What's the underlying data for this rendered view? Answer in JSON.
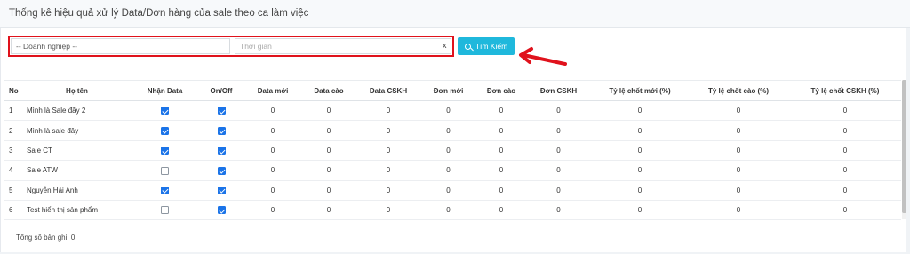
{
  "page": {
    "title": "Thống kê hiệu quả xử lý Data/Đơn hàng của sale theo ca làm việc"
  },
  "filters": {
    "company_select": "-- Doanh nghiệp --",
    "time_placeholder": "Thời gian",
    "clear_label": "x",
    "search_label": "Tìm Kiếm"
  },
  "colors": {
    "accent": "#1fb8dc",
    "highlight": "#e0121c",
    "checkbox": "#1a73e8"
  },
  "table": {
    "headers": [
      "No",
      "Họ tên",
      "Nhận Data",
      "On/Off",
      "Data mới",
      "Data cào",
      "Data CSKH",
      "Đơn mới",
      "Đơn cào",
      "Đơn CSKH",
      "Tỷ lệ chốt mới (%)",
      "Tỷ lệ chốt cào (%)",
      "Tỷ lệ chốt CSKH (%)"
    ],
    "rows": [
      {
        "no": "1",
        "name": "Mình là Sale đây 2",
        "nhan_data": true,
        "on_off": true,
        "values": [
          "0",
          "0",
          "0",
          "0",
          "0",
          "0",
          "0",
          "0",
          "0"
        ]
      },
      {
        "no": "2",
        "name": "Mình là sale đây",
        "nhan_data": true,
        "on_off": true,
        "values": [
          "0",
          "0",
          "0",
          "0",
          "0",
          "0",
          "0",
          "0",
          "0"
        ]
      },
      {
        "no": "3",
        "name": "Sale CT",
        "nhan_data": true,
        "on_off": true,
        "values": [
          "0",
          "0",
          "0",
          "0",
          "0",
          "0",
          "0",
          "0",
          "0"
        ]
      },
      {
        "no": "4",
        "name": "Sale ATW",
        "nhan_data": false,
        "on_off": true,
        "values": [
          "0",
          "0",
          "0",
          "0",
          "0",
          "0",
          "0",
          "0",
          "0"
        ]
      },
      {
        "no": "5",
        "name": "Nguyễn Hải Anh",
        "nhan_data": true,
        "on_off": true,
        "values": [
          "0",
          "0",
          "0",
          "0",
          "0",
          "0",
          "0",
          "0",
          "0"
        ]
      },
      {
        "no": "6",
        "name": "Test hiển thị sản phẩm",
        "nhan_data": false,
        "on_off": true,
        "values": [
          "0",
          "0",
          "0",
          "0",
          "0",
          "0",
          "0",
          "0",
          "0"
        ]
      }
    ]
  },
  "footer": {
    "total_label": "Tổng số bản ghi: 0"
  }
}
